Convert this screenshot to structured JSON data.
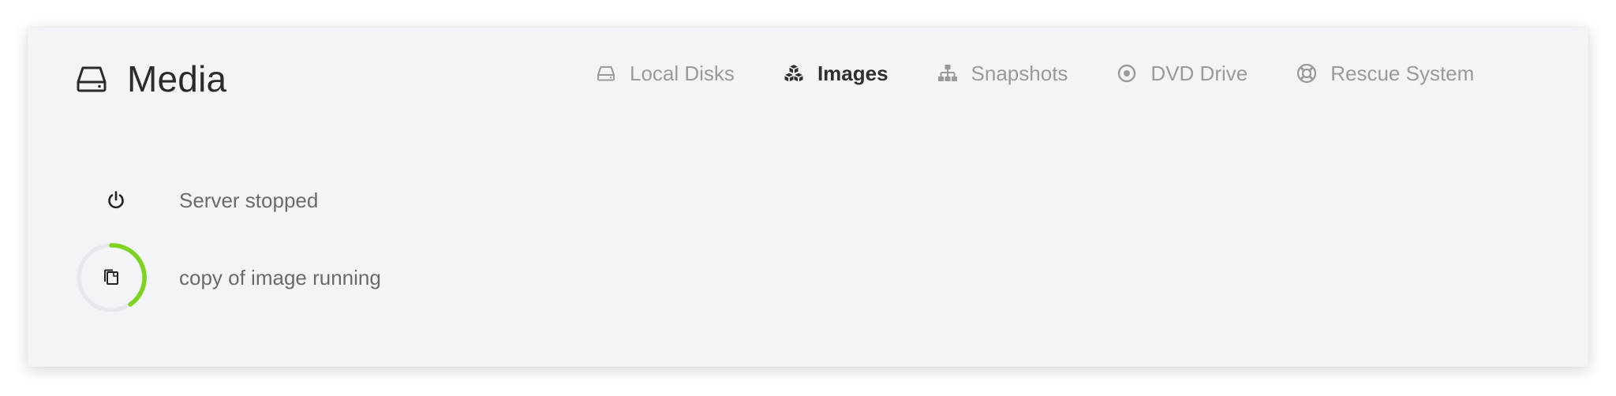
{
  "header": {
    "title": "Media",
    "icon": "hard-drive-icon"
  },
  "tabs": [
    {
      "label": "Local Disks",
      "icon": "hard-drive-icon",
      "active": false
    },
    {
      "label": "Images",
      "icon": "cubes-icon",
      "active": true
    },
    {
      "label": "Snapshots",
      "icon": "sitemap-icon",
      "active": false
    },
    {
      "label": "DVD Drive",
      "icon": "disc-icon",
      "active": false
    },
    {
      "label": "Rescue System",
      "icon": "life-ring-icon",
      "active": false
    }
  ],
  "status": [
    {
      "text": "Server stopped",
      "icon": "power-icon"
    },
    {
      "text": "copy of image running",
      "icon": "copy-icon",
      "progress_indicator": "spinner",
      "accent_color": "#7ed321"
    }
  ],
  "colors": {
    "panel_background": "#f3f4f8",
    "tab_inactive": "#9a9a9a",
    "tab_active": "#2f2f2f",
    "spinner_accent": "#7ed321"
  }
}
